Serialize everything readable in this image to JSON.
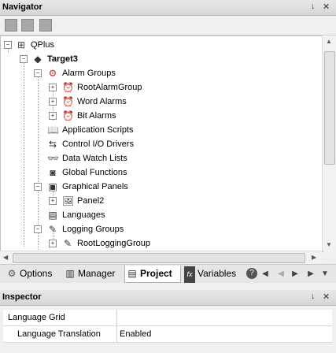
{
  "navigator": {
    "title": "Navigator",
    "pin": "↓",
    "close": "✕",
    "tree": [
      {
        "label": "QPlus",
        "icon": "⊞",
        "expander": "−"
      },
      {
        "label": "Target3",
        "icon": "◆",
        "expander": "−"
      },
      {
        "label": "Alarm Groups",
        "icon": "⚙",
        "expander": "−"
      },
      {
        "label": "RootAlarmGroup",
        "icon": "⏰",
        "expander": "+"
      },
      {
        "label": "Word Alarms",
        "icon": "⏰",
        "expander": "+"
      },
      {
        "label": "Bit Alarms",
        "icon": "⏰",
        "expander": "+"
      },
      {
        "label": "Application Scripts",
        "icon": "📖"
      },
      {
        "label": "Control I/O Drivers",
        "icon": "⇆"
      },
      {
        "label": "Data Watch Lists",
        "icon": "👓"
      },
      {
        "label": "Global Functions",
        "icon": "◙"
      },
      {
        "label": "Graphical Panels",
        "icon": "▣",
        "expander": "−"
      },
      {
        "label": "Panel2",
        "icon": "🖼",
        "expander": "+"
      },
      {
        "label": "Languages",
        "icon": "▤"
      },
      {
        "label": "Logging Groups",
        "icon": "✎",
        "expander": "−"
      },
      {
        "label": "RootLoggingGroup",
        "icon": "✎",
        "expander": "+"
      }
    ]
  },
  "tabs": [
    {
      "label": "Options",
      "icon": "⚙"
    },
    {
      "label": "Manager",
      "icon": "▥"
    },
    {
      "label": "Project",
      "icon": "▤"
    },
    {
      "label": "Variables",
      "icon": "fx"
    }
  ],
  "tab_nav": [
    "?",
    "◀",
    "◀",
    "▶",
    "▶",
    "▼"
  ],
  "inspector": {
    "title": "Inspector",
    "pin": "↓",
    "close": "✕",
    "rows": [
      {
        "key": "Language Grid",
        "value": ""
      },
      {
        "key": "Language Translation",
        "value": "Enabled"
      }
    ]
  }
}
